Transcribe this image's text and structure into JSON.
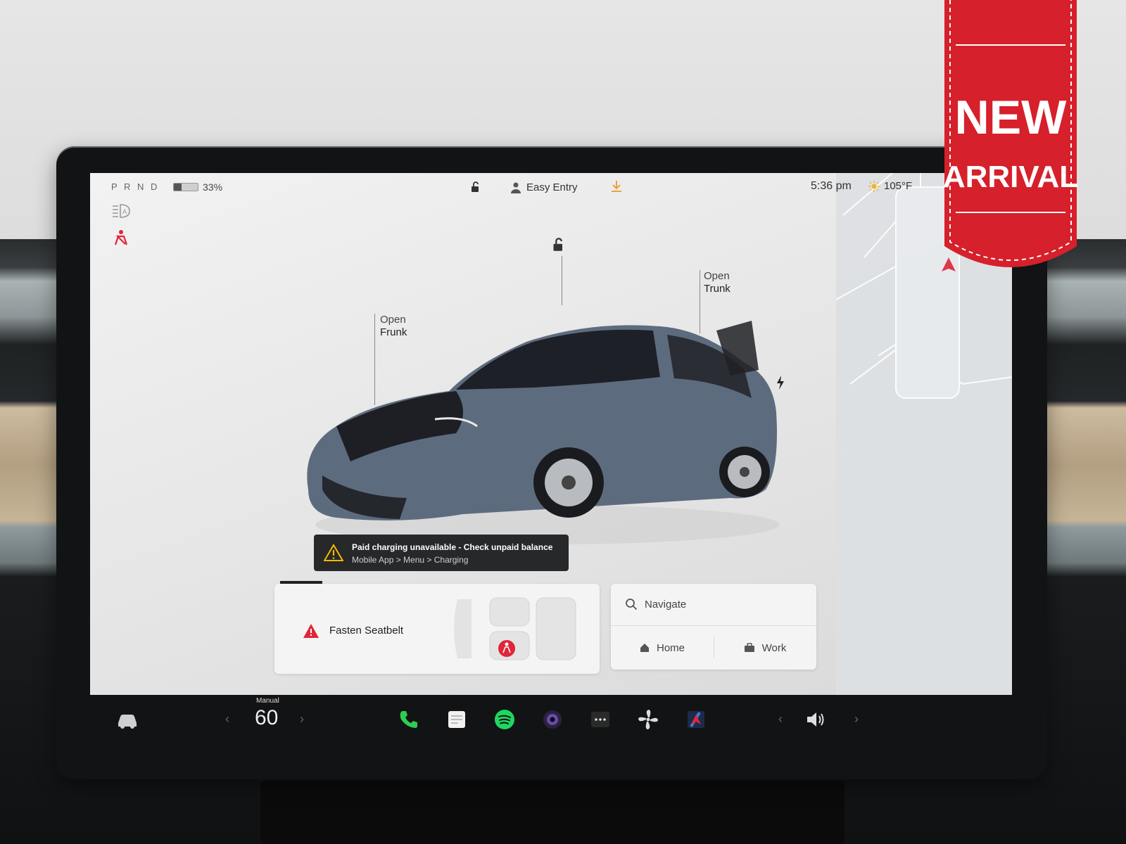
{
  "status_bar": {
    "gear": "P R N D",
    "battery_percent": "33%",
    "battery_level": 0.33,
    "profile_label": "Easy Entry",
    "time": "5:36 pm",
    "temperature": "105°F"
  },
  "callouts": {
    "frunk": {
      "line1": "Open",
      "line2": "Frunk"
    },
    "trunk": {
      "line1": "Open",
      "line2": "Trunk"
    }
  },
  "toast": {
    "title": "Paid charging unavailable - Check unpaid balance",
    "subtitle": "Mobile App > Menu > Charging"
  },
  "seatbelt_card": {
    "label": "Fasten Seatbelt"
  },
  "navigation": {
    "search_placeholder": "Navigate",
    "home_label": "Home",
    "work_label": "Work"
  },
  "taskbar": {
    "speed_mode": "Manual",
    "speed_value": "60"
  },
  "badge": {
    "line1": "NEW",
    "line2": "ARRIVAL"
  },
  "colors": {
    "alert_red": "#e0263a",
    "toast_bg": "#26282a",
    "warning_yellow": "#f5b800",
    "badge_red": "#d6202b"
  }
}
